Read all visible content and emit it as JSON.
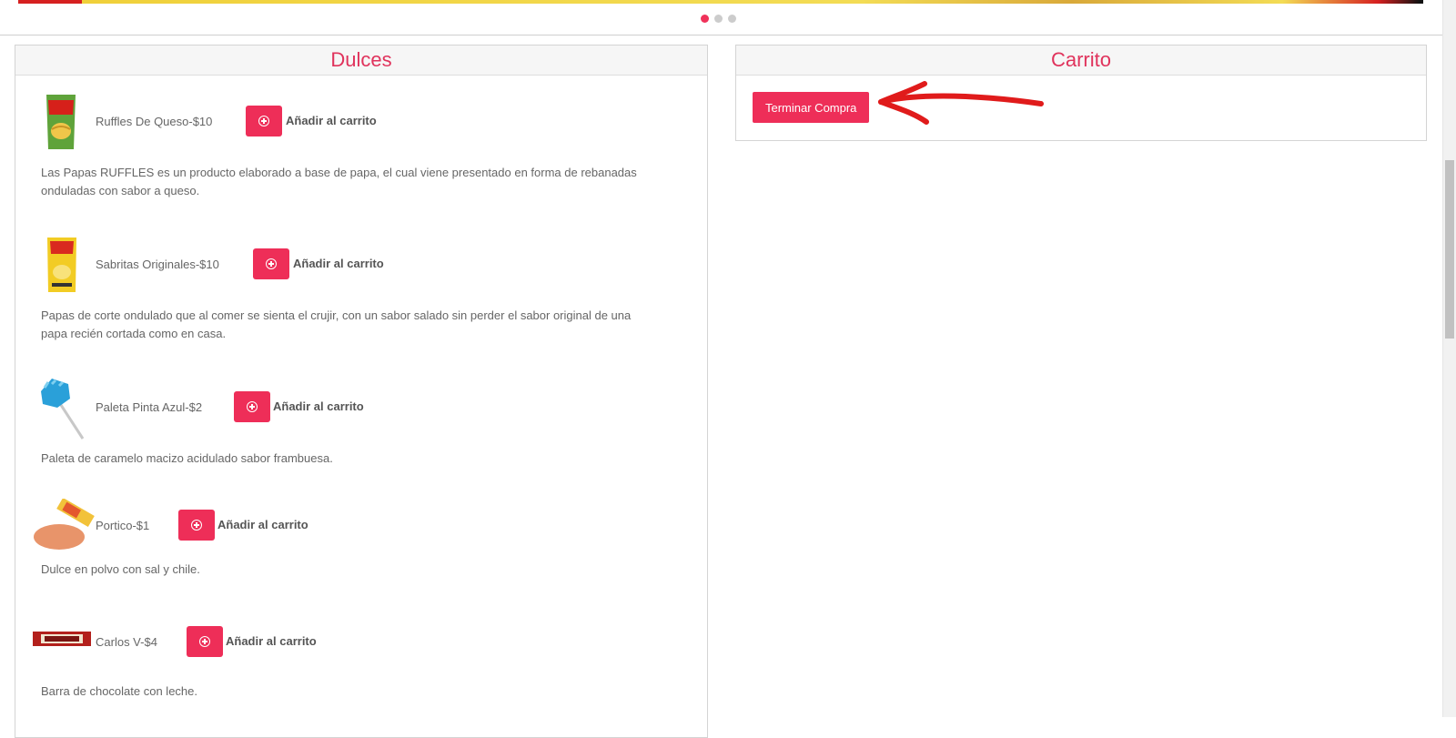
{
  "carousel": {
    "dots": 3,
    "active_index": 0
  },
  "sections": {
    "dulces_title": "Dulces",
    "carrito_title": "Carrito"
  },
  "products": [
    {
      "name": "Ruffles De Queso-$10",
      "add_label": "Añadir al carrito",
      "description": "Las Papas RUFFLES es un producto elaborado a base de papa, el cual viene presentado en forma de rebanadas onduladas con sabor a queso.",
      "image_icon": "ruffles-bag-icon"
    },
    {
      "name": "Sabritas Originales-$10",
      "add_label": "Añadir al carrito",
      "description": "Papas de corte ondulado que al comer se sienta el crujir, con un sabor salado sin perder el sabor original de una papa recién cortada como en casa.",
      "image_icon": "sabritas-bag-icon"
    },
    {
      "name": "Paleta Pinta Azul-$2",
      "add_label": "Añadir al carrito",
      "description": "Paleta de caramelo macizo acidulado sabor frambuesa.",
      "image_icon": "lollipop-icon"
    },
    {
      "name": "Portico-$1",
      "add_label": "Añadir al carrito",
      "description": "Dulce en polvo con sal y chile.",
      "image_icon": "powder-candy-icon"
    },
    {
      "name": "Carlos V-$4",
      "add_label": "Añadir al carrito",
      "description": "Barra de chocolate con leche.",
      "image_icon": "chocolate-bar-icon"
    }
  ],
  "cart": {
    "checkout_label": "Terminar Compra"
  },
  "colors": {
    "accent": "#ee2e58",
    "title": "#e0335c",
    "arrow": "#e01b1b"
  }
}
